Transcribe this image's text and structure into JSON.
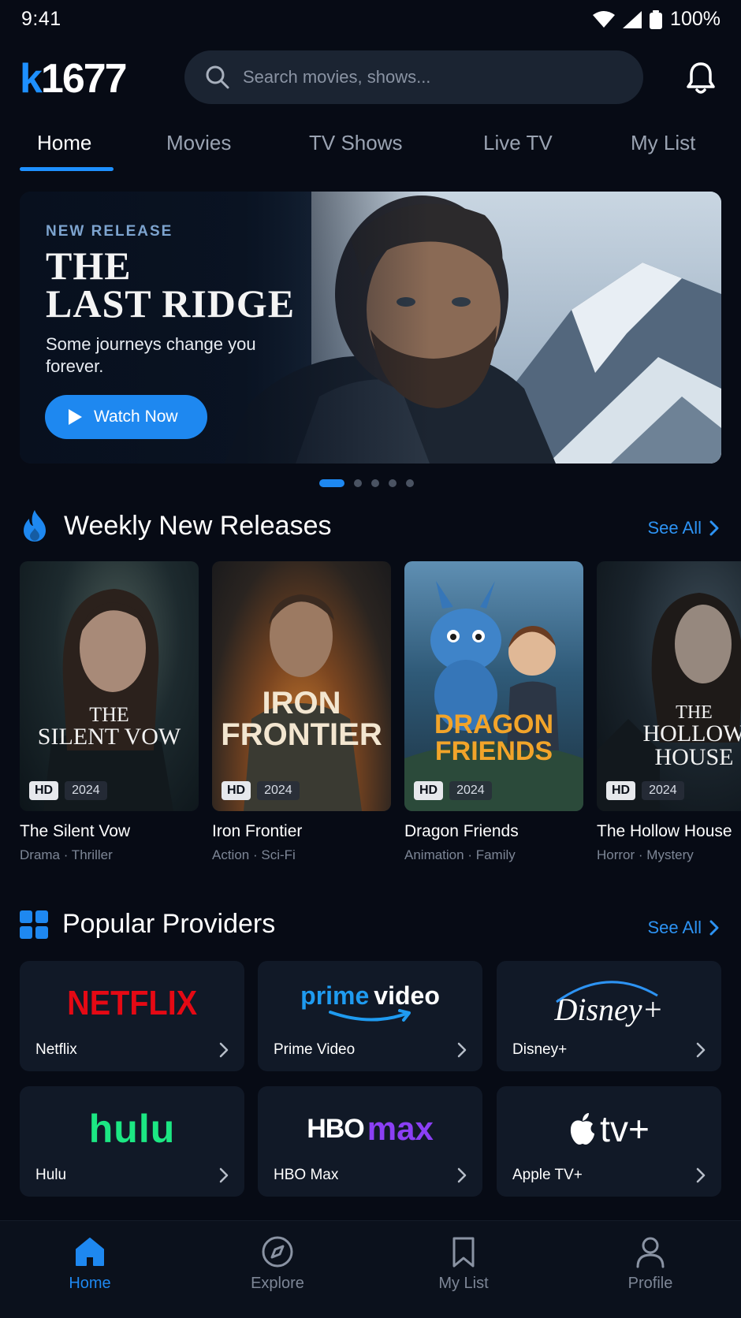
{
  "status": {
    "time": "9:41",
    "battery": "100%"
  },
  "header": {
    "logo_k": "k",
    "logo_rest": "1677",
    "search_placeholder": "Search movies, shows..."
  },
  "tabs": [
    {
      "label": "Home",
      "active": true
    },
    {
      "label": "Movies",
      "active": false
    },
    {
      "label": "TV Shows",
      "active": false
    },
    {
      "label": "Live TV",
      "active": false
    },
    {
      "label": "My List",
      "active": false
    }
  ],
  "hero": {
    "kicker": "NEW RELEASE",
    "title_line1": "THE",
    "title_line2": "LAST RIDGE",
    "subtitle": "Some journeys change you forever.",
    "button_label": "Watch Now",
    "slide_count": 5,
    "active_slide": 1
  },
  "weekly": {
    "title": "Weekly New Releases",
    "see_all": "See All",
    "items": [
      {
        "poster_title_l1": "THE",
        "poster_title_l2": "SILENT VOW",
        "badge": "HD",
        "year": "2024",
        "name": "The Silent Vow",
        "genre": "Drama · Thriller"
      },
      {
        "poster_title_l1": "IRON",
        "poster_title_l2": "FRONTIER",
        "badge": "HD",
        "year": "2024",
        "name": "Iron Frontier",
        "genre": "Action · Sci-Fi"
      },
      {
        "poster_title_l1": "DRAGON",
        "poster_title_l2": "FRIENDS",
        "badge": "HD",
        "year": "2024",
        "name": "Dragon Friends",
        "genre": "Animation · Family"
      },
      {
        "poster_title_l1": "THE",
        "poster_title_l2": "HOLLOW",
        "poster_title_l3": "HOUSE",
        "badge": "HD",
        "year": "2024",
        "name": "The Hollow House",
        "genre": "Horror · Mystery"
      }
    ]
  },
  "providers": {
    "title": "Popular Providers",
    "see_all": "See All",
    "items": [
      {
        "name": "Netflix",
        "logo_text": "NETFLIX",
        "color": "#e50914"
      },
      {
        "name": "Prime Video",
        "logo_text_a": "prime",
        "logo_text_b": "video",
        "color": "#1f9bf0"
      },
      {
        "name": "Disney+",
        "logo_text": "Disney+",
        "color": "#ffffff"
      },
      {
        "name": "Hulu",
        "logo_text": "hulu",
        "color": "#1ce783"
      },
      {
        "name": "HBO Max",
        "logo_text_a": "HBO",
        "logo_text_b": "max",
        "color": "#8b3ff5"
      },
      {
        "name": "Apple TV+",
        "logo_text": "tv+",
        "color": "#ffffff"
      }
    ]
  },
  "bottom_nav": [
    {
      "label": "Home",
      "icon": "home-icon",
      "active": true
    },
    {
      "label": "Explore",
      "icon": "compass-icon",
      "active": false
    },
    {
      "label": "My List",
      "icon": "bookmark-icon",
      "active": false
    },
    {
      "label": "Profile",
      "icon": "user-icon",
      "active": false
    }
  ],
  "colors": {
    "accent": "#1e88f0",
    "background": "#070b15",
    "card": "#111927"
  }
}
